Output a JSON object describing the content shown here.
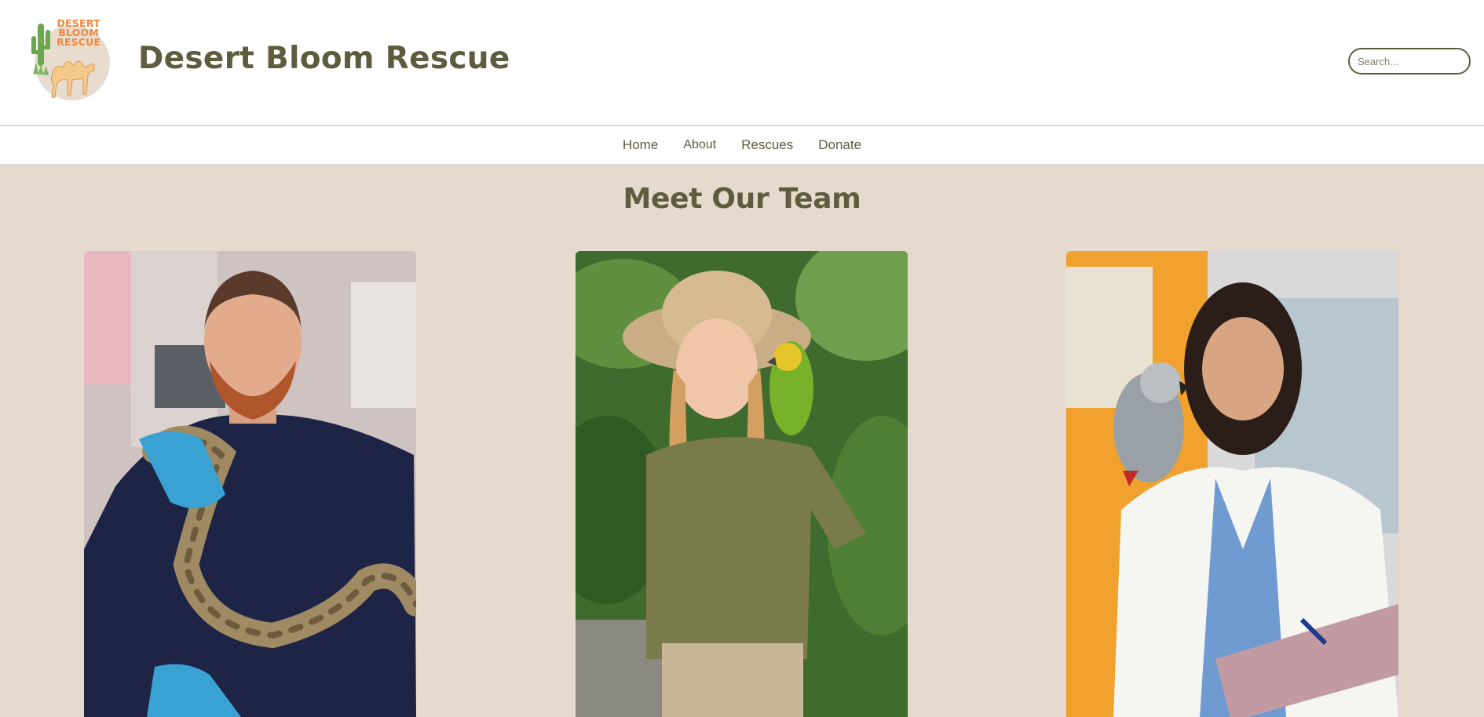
{
  "header": {
    "logo_lines": [
      "DESERT",
      "BLOOM",
      "RESCUE"
    ],
    "site_title": "Desert Bloom Rescue",
    "search_placeholder": "Search..."
  },
  "nav": {
    "items": [
      "Home",
      "About",
      "Rescues",
      "Donate"
    ]
  },
  "main": {
    "section_title": "Meet Our Team",
    "team_photos": [
      {
        "description_icon": "vet-with-snake-photo"
      },
      {
        "description_icon": "zookeeper-with-parrot-photo"
      },
      {
        "description_icon": "doctor-with-grey-parrot-photo"
      }
    ]
  },
  "colors": {
    "brand_text": "#5e5c3e",
    "page_background": "#e6d9cd",
    "logo_accent": "#f0883c"
  }
}
